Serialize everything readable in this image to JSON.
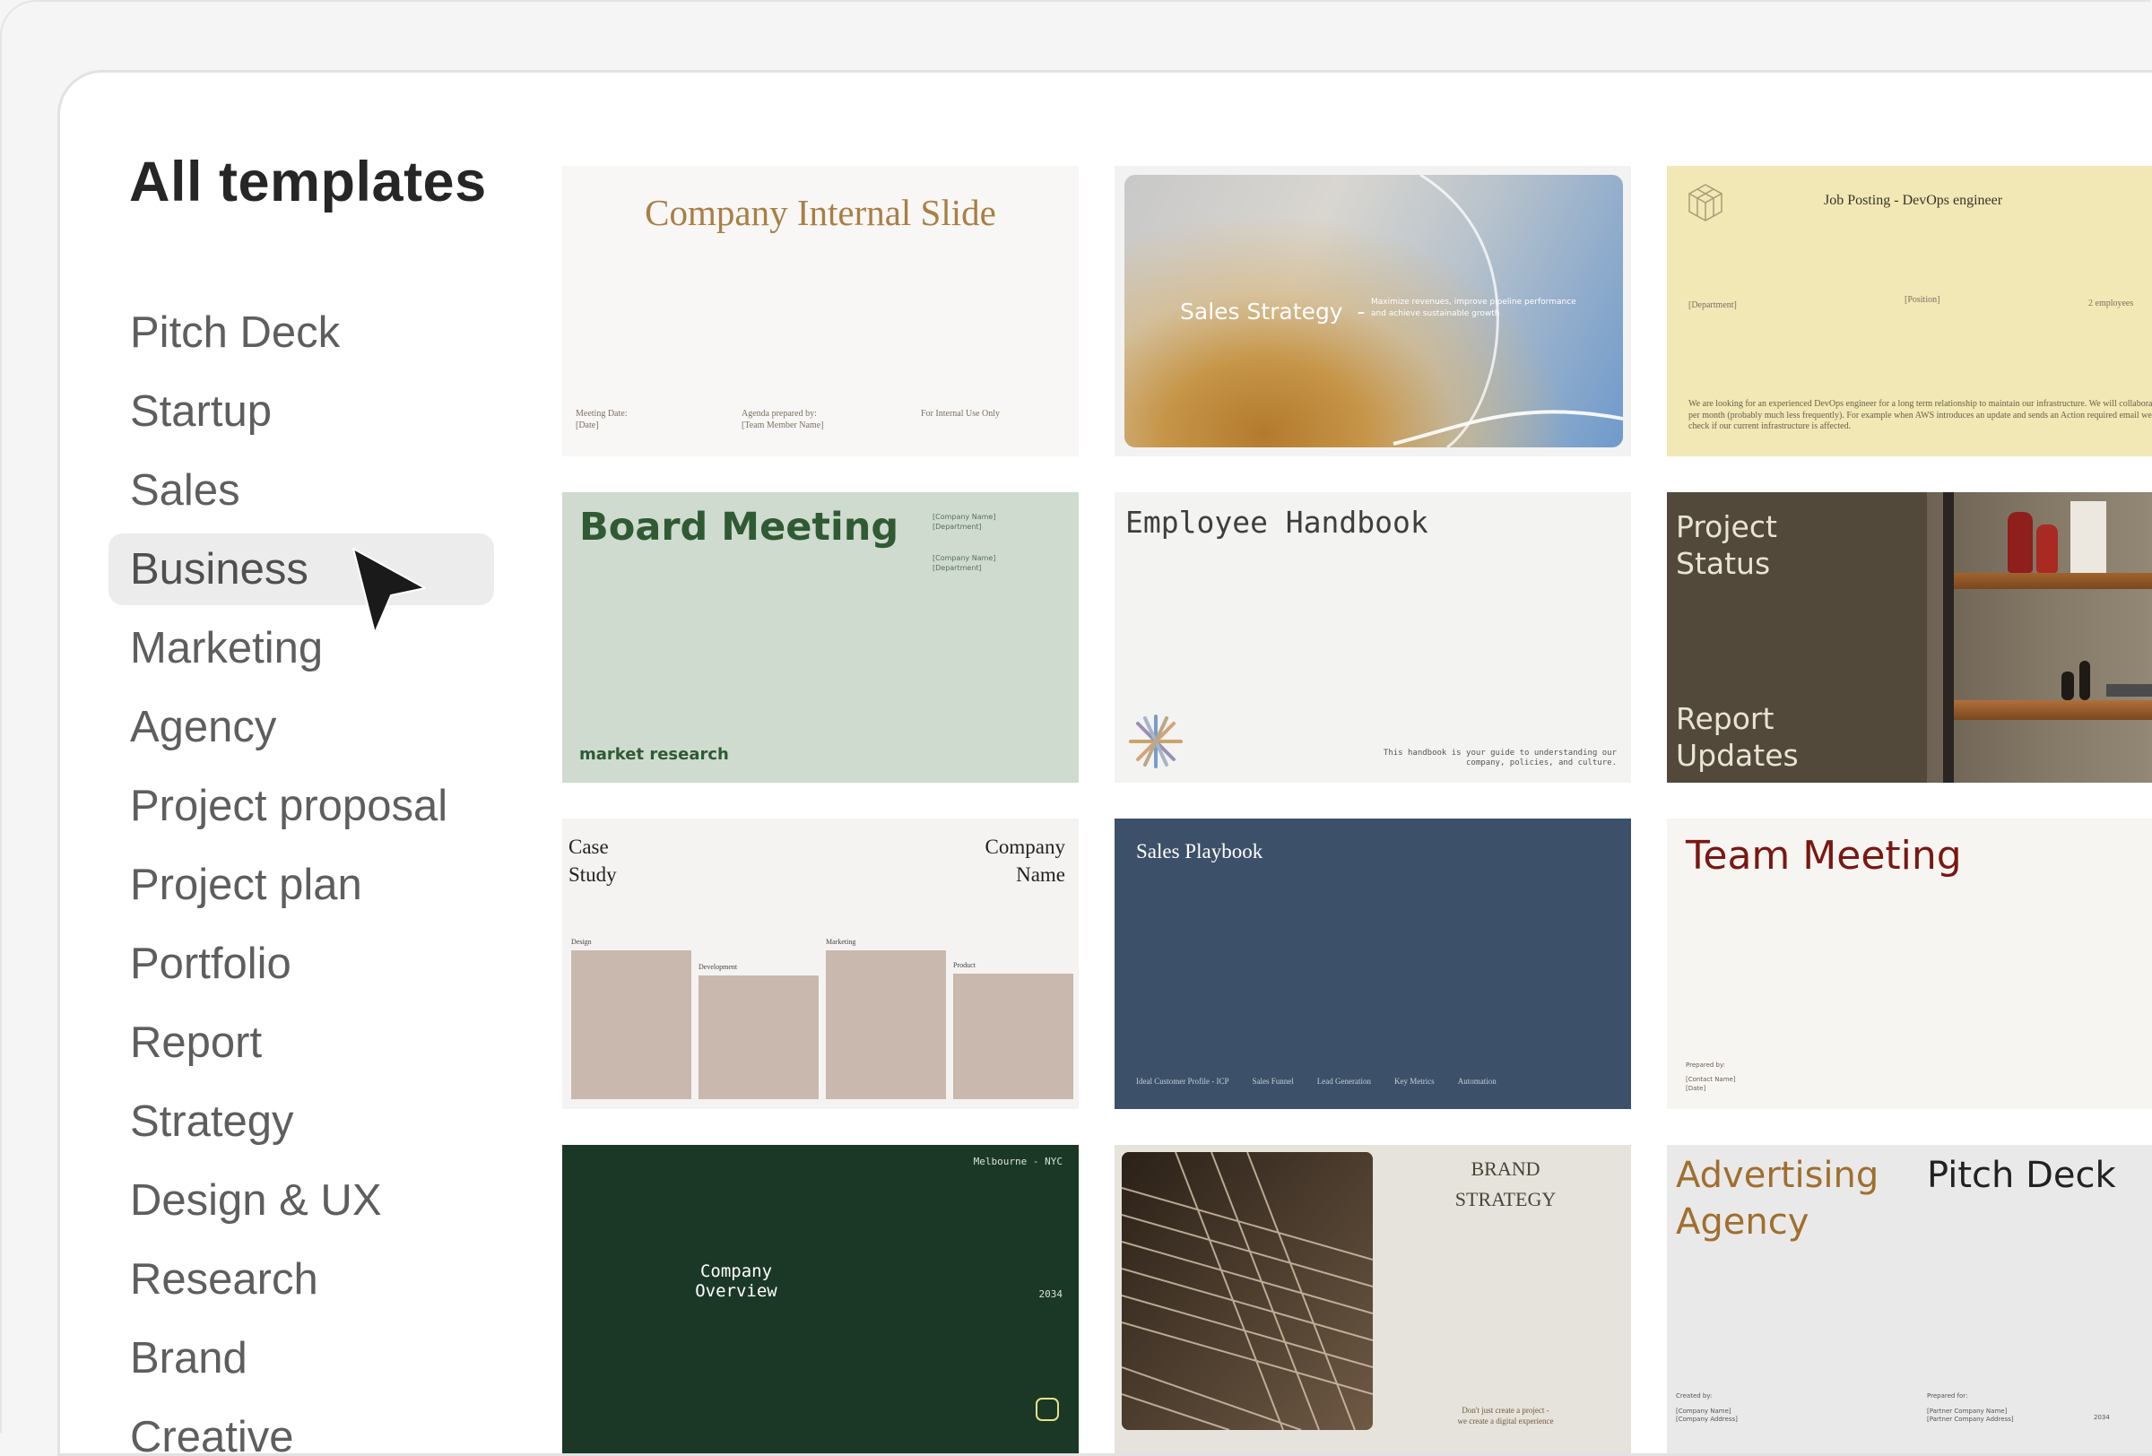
{
  "sidebar": {
    "title": "All templates",
    "items": [
      {
        "label": "Pitch Deck"
      },
      {
        "label": "Startup"
      },
      {
        "label": "Sales"
      },
      {
        "label": "Business",
        "selected": true
      },
      {
        "label": "Marketing"
      },
      {
        "label": "Agency"
      },
      {
        "label": "Project proposal"
      },
      {
        "label": "Project plan"
      },
      {
        "label": "Portfolio"
      },
      {
        "label": "Report"
      },
      {
        "label": "Strategy"
      },
      {
        "label": "Design & UX"
      },
      {
        "label": "Research"
      },
      {
        "label": "Brand"
      },
      {
        "label": "Creative"
      }
    ]
  },
  "templates": {
    "company_internal": {
      "title": "Company Internal Slide",
      "meeting_date_label": "Meeting Date:",
      "meeting_date_value": "[Date]",
      "agenda_label": "Agenda prepared by:",
      "agenda_value": "[Team Member Name]",
      "internal_note": "For Internal Use Only"
    },
    "sales_strategy": {
      "title": "Sales Strategy  -",
      "subtitle": "Maximize revenues, improve pipeline performance and achieve sustainable growth"
    },
    "job_posting": {
      "title": "Job Posting - DevOps engineer",
      "department": "[Department]",
      "position": "[Position]",
      "employees": "2 employees",
      "description": "We are looking for an experienced DevOps engineer for a long term relationship to maintain our infrastructure. We will collaborate 1-2 hours per month (probably much less frequently). For example when AWS introduces an update and sends an Action required email we need to check if our current infrastructure is affected."
    },
    "board_meeting": {
      "title": "Board Meeting",
      "company1": "[Company Name]",
      "dept1": "[Department]",
      "company2": "[Company Name]",
      "dept2": "[Department]",
      "footer": "market research"
    },
    "employee_handbook": {
      "title": "Employee Handbook",
      "description": "This handbook is your guide to understanding our company, policies, and culture."
    },
    "project_status": {
      "title_line1": "Project",
      "title_line2": "Status",
      "sub_line1": "Report",
      "sub_line2": "Updates"
    },
    "case_study": {
      "title_line1": "Case",
      "title_line2": "Study",
      "company_line1": "Company",
      "company_line2": "Name",
      "bars": [
        {
          "label": "Design",
          "value": 0.83
        },
        {
          "label": "Development",
          "value": 0.69
        },
        {
          "label": "Marketing",
          "value": 0.83
        },
        {
          "label": "Product",
          "value": 0.7
        }
      ]
    },
    "sales_playbook": {
      "title": "Sales Playbook",
      "nav": [
        "Ideal Customer Profile - ICP",
        "Sales Funnel",
        "Lead Generation",
        "Key Metrics",
        "Automation"
      ]
    },
    "team_meeting": {
      "title": "Team Meeting",
      "prepared_by_label": "Prepared by:",
      "contact": "[Contact Name]",
      "date": "[Date]"
    },
    "company_overview": {
      "location": "Melbourne - NYC",
      "title_line1": "Company",
      "title_line2": "Overview",
      "year": "2034"
    },
    "brand_strategy": {
      "title_line1": "BRAND",
      "title_line2": "STRATEGY",
      "tagline_line1": "Don't just create a project -",
      "tagline_line2": "we create a digital experience"
    },
    "advertising_agency": {
      "title_line1": "Advertising",
      "title_line2": "Agency",
      "title_right": "Pitch Deck",
      "created_by_label": "Created by:",
      "company_name": "[Company Name]",
      "company_address": "[Company Address]",
      "prepared_for_label": "Prepared for:",
      "partner_name": "[Partner Company Name]",
      "partner_address": "[Partner Company Address]",
      "year": "2034"
    }
  },
  "colors": {
    "accent_gold": "#a97f45",
    "board_green": "#2f5a34",
    "team_red": "#7a1712",
    "playbook_navy": "#3c5069",
    "overview_green": "#1b3826"
  }
}
